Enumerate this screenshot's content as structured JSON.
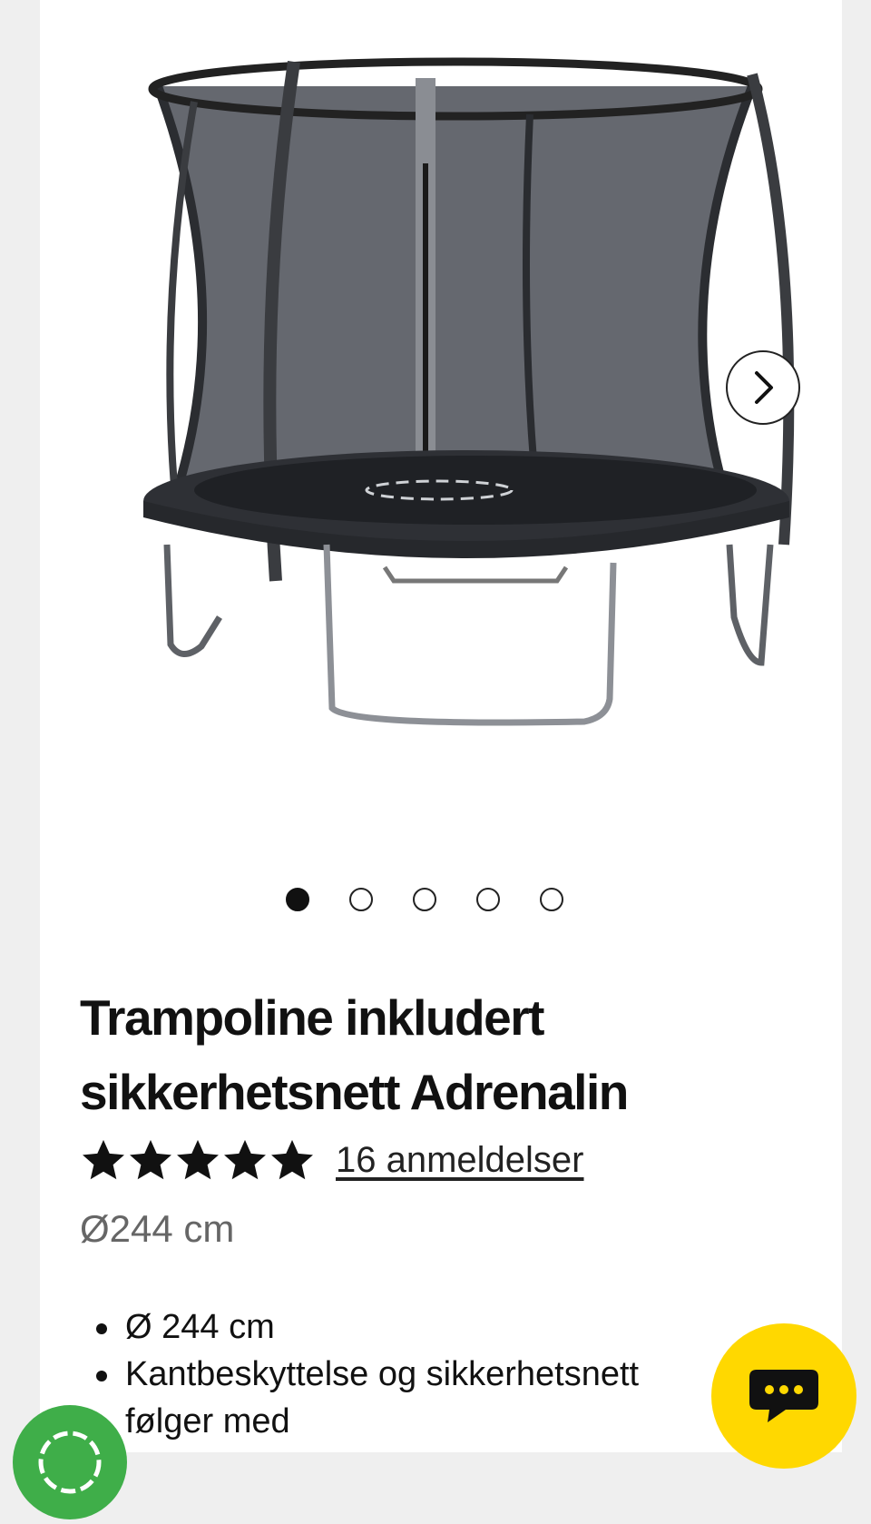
{
  "product": {
    "title": "Trampoline inkludert sikkerhetsnett Adrenalin",
    "rating": 5,
    "reviews_link": "16 anmeldelser",
    "size": "Ø244 cm",
    "features": [
      "Ø 244 cm",
      "Kantbeskyttelse og sikkerhetsnett følger med"
    ]
  },
  "gallery": {
    "image_count": 5,
    "active_index": 0
  },
  "icons": {
    "next": "chevron-right-icon",
    "chat": "chat-bubble-icon",
    "cookie": "cookie-icon"
  },
  "colors": {
    "chat_button": "#ffd800",
    "cookie_button": "#3fae49"
  }
}
